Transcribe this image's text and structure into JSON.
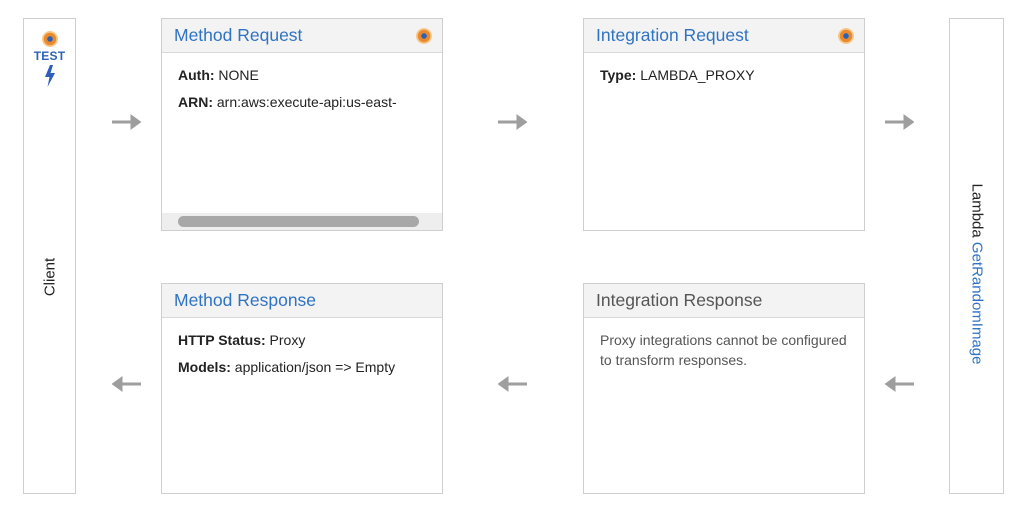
{
  "client": {
    "test_label": "TEST",
    "label": "Client",
    "icons": [
      "test-target-icon",
      "lightning-bolt-icon"
    ]
  },
  "method_request": {
    "title": "Method Request",
    "fields": [
      {
        "label": "Auth:",
        "value": " NONE"
      },
      {
        "label": "ARN:",
        "value": " arn:aws:execute-api:us-east-"
      }
    ]
  },
  "integration_request": {
    "title": "Integration Request",
    "fields": [
      {
        "label": "Type:",
        "value": " LAMBDA_PROXY"
      }
    ]
  },
  "method_response": {
    "title": "Method Response",
    "fields": [
      {
        "label": "HTTP Status:",
        "value": " Proxy"
      },
      {
        "label": "Models:",
        "value": " application/json => Empty"
      }
    ]
  },
  "integration_response": {
    "title": "Integration Response",
    "note": "Proxy integrations cannot be configured to transform responses."
  },
  "lambda": {
    "prefix": "Lambda",
    "function_name": "GetRandomImage"
  },
  "colors": {
    "link": "#2f73c2",
    "arrow": "#9e9e9e",
    "border": "#cfcfcf",
    "header_bg": "#f3f3f3",
    "icon_orange": "#e98a2f",
    "icon_blue": "#2b5fb8"
  }
}
